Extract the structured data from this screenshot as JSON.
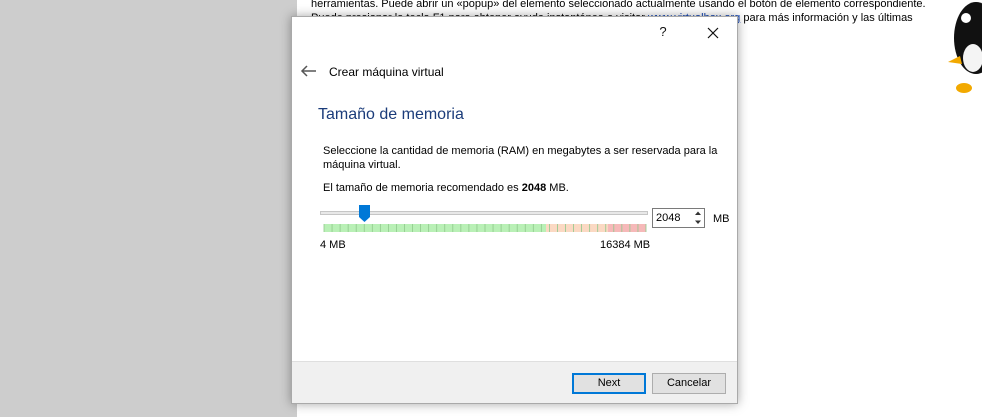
{
  "background": {
    "line1": "herramientas. Puede abrir un «popup» del elemento seleccionado actualmente usando el botón de elemento correspondiente.",
    "line2_prefix": "Puede presionar la tecla F1 para obtener ayuda instantánea o visitar",
    "line2_link": "www.virtualbox.org",
    "line2_suffix": "para más información y las últimas"
  },
  "dialog": {
    "help_label": "?",
    "wizard_title": "Crear máquina virtual",
    "section_title": "Tamaño de memoria",
    "description": "Seleccione la cantidad de memoria (RAM) en megabytes a ser reservada para la máquina virtual.",
    "recommend_prefix": "El tamaño de memoria recomendado es",
    "recommend_value": "2048",
    "recommend_suffix": "MB.",
    "memory": {
      "value": "2048",
      "min": 4,
      "max": 16384,
      "unit": "MB",
      "min_label": "4 MB",
      "max_label": "16384 MB"
    },
    "buttons": {
      "next": "Next",
      "cancel": "Cancelar"
    }
  },
  "colors": {
    "title_blue": "#1b3c7a",
    "slider_thumb": "#0078d7",
    "zone_green": "#b9f0b6",
    "zone_orange": "#fbd9c3",
    "zone_red": "#f6b9b9"
  }
}
